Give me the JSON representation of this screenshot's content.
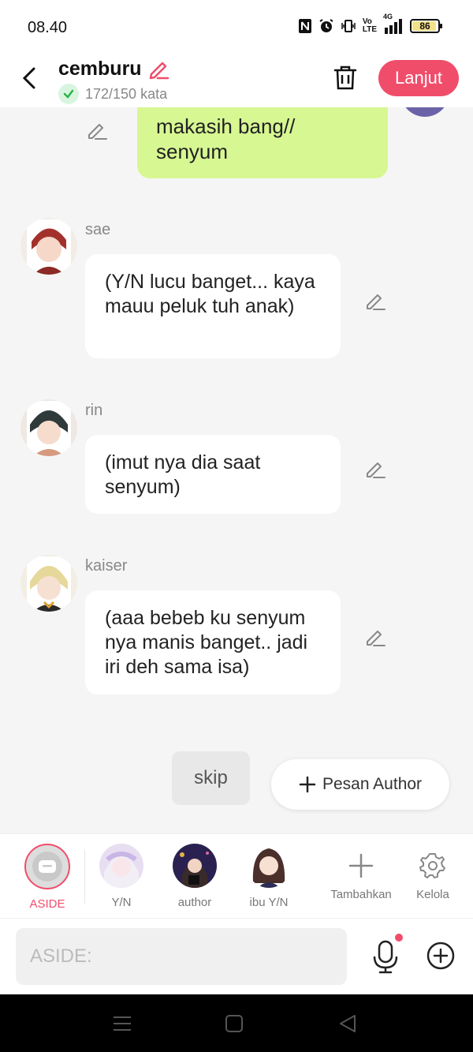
{
  "status_bar": {
    "time": "08.40",
    "network": "4G",
    "battery": "86"
  },
  "header": {
    "title": "cemburu",
    "word_count": "172/150 kata",
    "next_label": "Lanjut"
  },
  "chat": {
    "my_message": "makasih bang// senyum",
    "messages": [
      {
        "name": "sae",
        "text": "(Y/N lucu banget... kaya mauu peluk tuh anak)"
      },
      {
        "name": "rin",
        "text": "(imut nya dia saat senyum)"
      },
      {
        "name": "kaiser",
        "text": "(aaa bebeb ku senyum nya manis banget.. jadi iri deh sama isa)"
      }
    ],
    "skip_label": "skip",
    "author_msg_label": "Pesan Author"
  },
  "characters": [
    {
      "label": "ASIDE"
    },
    {
      "label": "Y/N"
    },
    {
      "label": "author"
    },
    {
      "label": "ibu Y/N"
    },
    {
      "label": "Tambahkan"
    },
    {
      "label": "Kelola"
    }
  ],
  "input": {
    "placeholder": "ASIDE:"
  },
  "colors": {
    "accent": "#f04d6b",
    "my_bubble": "#d7f792",
    "background": "#f5f5f5"
  }
}
